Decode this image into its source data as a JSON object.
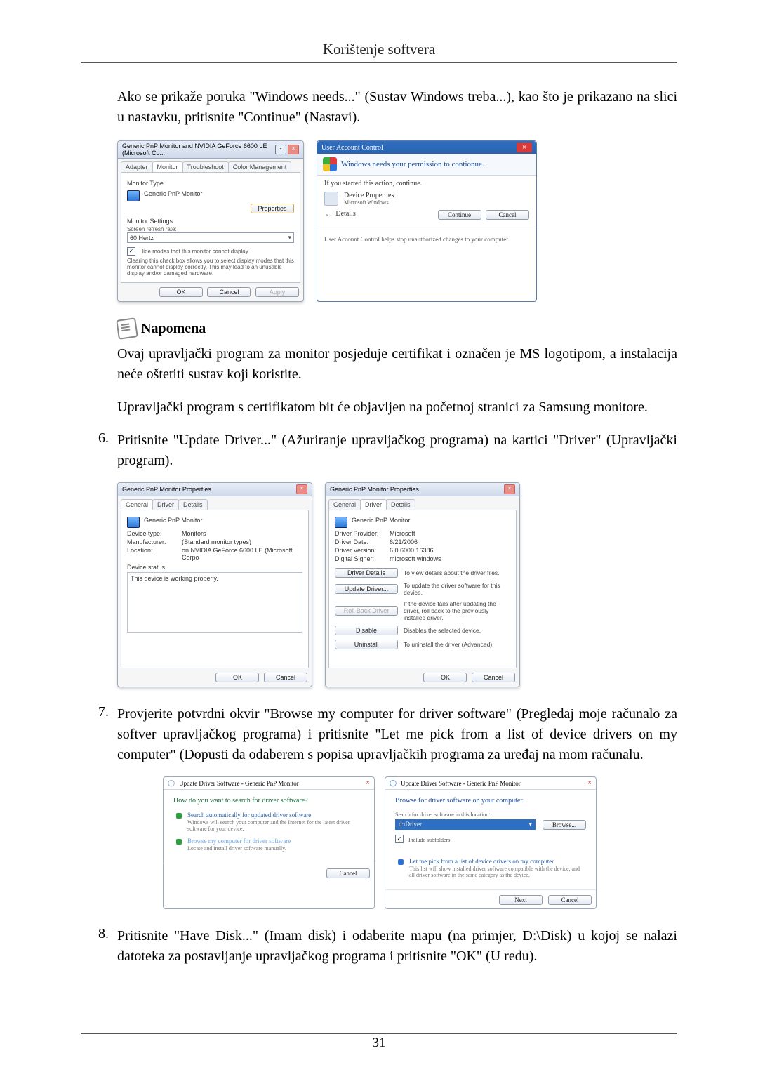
{
  "header": {
    "title": "Korištenje softvera"
  },
  "intro_para": "Ako se prikaže poruka \"Windows needs...\" (Sustav Windows treba...), kao što je prikazano na slici u nastavku, pritisnite \"Continue\" (Nastavi).",
  "fig1": {
    "left": {
      "title": "Generic PnP Monitor and NVIDIA GeForce 6600 LE (Microsoft Co...",
      "tabs": [
        "Adapter",
        "Monitor",
        "Troubleshoot",
        "Color Management"
      ],
      "monitor_type_label": "Monitor Type",
      "monitor_type_value": "Generic PnP Monitor",
      "properties_btn": "Properties",
      "settings_label": "Monitor Settings",
      "refresh_label": "Screen refresh rate:",
      "refresh_value": "60 Hertz",
      "hide_modes_checked": true,
      "hide_modes_label": "Hide modes that this monitor cannot display",
      "hide_modes_help": "Clearing this check box allows you to select display modes that this monitor cannot display correctly. This may lead to an unusable display and/or damaged hardware.",
      "ok": "OK",
      "cancel": "Cancel",
      "apply": "Apply"
    },
    "right": {
      "title": "User Account Control",
      "headline": "Windows needs your permission to contionue.",
      "started": "If you started this action, continue.",
      "app_name": "Device Properties",
      "publisher": "Microsoft Windows",
      "details_label": "Details",
      "continue": "Continue",
      "cancel": "Cancel",
      "footer": "User Account Control helps stop unauthorized changes to your computer."
    }
  },
  "note": {
    "heading": "Napomena",
    "p1": "Ovaj upravljački program za monitor posjeduje certifikat i označen je MS logotipom, a instalacija neće oštetiti sustav koji koristite.",
    "p2": "Upravljački program s certifikatom bit će objavljen na početnoj stranici za Samsung monitore."
  },
  "step6_num": "6.",
  "step6": "Pritisnite \"Update Driver...\" (Ažuriranje upravljačkog programa) na kartici \"Driver\" (Upravljački program).",
  "fig2": {
    "left": {
      "title": "Generic PnP Monitor Properties",
      "tabs": [
        "General",
        "Driver",
        "Details"
      ],
      "heading": "Generic PnP Monitor",
      "rows": {
        "type_k": "Device type:",
        "type_v": "Monitors",
        "man_k": "Manufacturer:",
        "man_v": "(Standard monitor types)",
        "loc_k": "Location:",
        "loc_v": "on NVIDIA GeForce 6600 LE (Microsoft Corpo"
      },
      "status_label": "Device status",
      "status_value": "This device is working properly.",
      "ok": "OK",
      "cancel": "Cancel"
    },
    "right": {
      "title": "Generic PnP Monitor Properties",
      "tabs": [
        "General",
        "Driver",
        "Details"
      ],
      "heading": "Generic PnP Monitor",
      "rows": {
        "prov_k": "Driver Provider:",
        "prov_v": "Microsoft",
        "date_k": "Driver Date:",
        "date_v": "6/21/2006",
        "ver_k": "Driver Version:",
        "ver_v": "6.0.6000.16386",
        "sign_k": "Digital Signer:",
        "sign_v": "microsoft windows"
      },
      "btn_details": "Driver Details",
      "desc_details": "To view details about the driver files.",
      "btn_update": "Update Driver...",
      "desc_update": "To update the driver software for this device.",
      "btn_rollback": "Roll Back Driver",
      "desc_rollback": "If the device fails after updating the driver, roll back to the previously installed driver.",
      "btn_disable": "Disable",
      "desc_disable": "Disables the selected device.",
      "btn_uninstall": "Uninstall",
      "desc_uninstall": "To uninstall the driver (Advanced).",
      "ok": "OK",
      "cancel": "Cancel"
    }
  },
  "step7_num": "7.",
  "step7": "Provjerite potvrdni okvir \"Browse my computer for driver software\" (Pregledaj moje računalo za softver upravljačkog programa) i pritisnite \"Let me pick from a list of device drivers on my computer\" (Dopusti da odaberem s popisa upravljačkih programa za uređaj na mom računalu.",
  "fig3": {
    "left": {
      "bread": "Update Driver Software - Generic PnP Monitor",
      "question": "How do you want to search for driver software?",
      "opt1_title": "Search automatically for updated driver software",
      "opt1_desc": "Windows will search your computer and the Internet for the latest driver software for your device.",
      "opt2_title": "Browse my computer for driver software",
      "opt2_desc": "Locate and install driver software manually.",
      "cancel": "Cancel"
    },
    "right": {
      "bread": "Update Driver Software - Generic PnP Monitor",
      "heading": "Browse for driver software on your computer",
      "path_label": "Search for driver software in this location:",
      "path_value": "d:\\Driver",
      "browse": "Browse...",
      "include": "Include subfolders",
      "pick_title": "Let me pick from a list of device drivers on my computer",
      "pick_desc": "This list will show installed driver software compatible with the device, and all driver software in the same category as the device.",
      "next": "Next",
      "cancel": "Cancel"
    }
  },
  "step8_num": "8.",
  "step8": "Pritisnite \"Have Disk...\" (Imam disk) i odaberite mapu (na primjer, D:\\Disk) u kojoj se nalazi datoteka za postavljanje upravljačkog programa i pritisnite \"OK\" (U redu).",
  "page_number": "31"
}
